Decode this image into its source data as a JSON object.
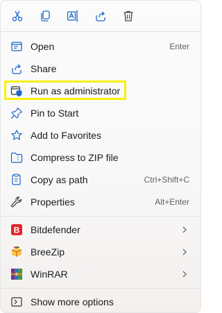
{
  "toolbar": {
    "items": [
      {
        "name": "cut-icon"
      },
      {
        "name": "copy-icon"
      },
      {
        "name": "rename-icon"
      },
      {
        "name": "share-icon"
      },
      {
        "name": "delete-icon"
      }
    ]
  },
  "menu": {
    "open": {
      "label": "Open",
      "shortcut": "Enter"
    },
    "share": {
      "label": "Share"
    },
    "run_admin": {
      "label": "Run as administrator"
    },
    "pin_start": {
      "label": "Pin to Start"
    },
    "add_favorites": {
      "label": "Add to Favorites"
    },
    "compress_zip": {
      "label": "Compress to ZIP file"
    },
    "copy_path": {
      "label": "Copy as path",
      "shortcut": "Ctrl+Shift+C"
    },
    "properties": {
      "label": "Properties",
      "shortcut": "Alt+Enter"
    },
    "bitdefender": {
      "label": "Bitdefender"
    },
    "breezip": {
      "label": "BreeZip"
    },
    "winrar": {
      "label": "WinRAR"
    },
    "more_options": {
      "label": "Show more options"
    }
  },
  "colors": {
    "accent": "#1a66c9",
    "highlight": "#f7f20a",
    "bitdefender_red": "#e3242b"
  }
}
